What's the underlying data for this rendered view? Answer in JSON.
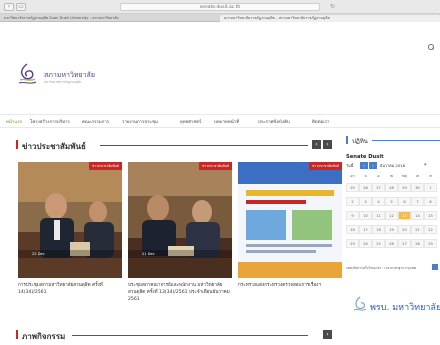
{
  "browser": {
    "url": "senate.dusit.ac.th",
    "reload_icon": "reload-icon",
    "tabs": [
      {
        "label": "มหาวิทยาลัยราชภัฏสวนดุสิต Suan Dusit University – สภามหาวิทยาลัย"
      },
      {
        "label": "สภามหาวิทยาลัยราชภัฏสวนดุสิต – สภามหาวิทยาลัยราชภัฏสวนดุสิต"
      }
    ]
  },
  "header": {
    "logo_text": "สภามหาวิทยาลัย",
    "logo_sub": "มหาวิทยาลัยราชภัฏสวนดุสิต"
  },
  "nav": {
    "items": [
      {
        "label": "หน้าแรก"
      },
      {
        "label": "โครงสร้างการบริหาร"
      },
      {
        "label": "คณะกรรมการ"
      },
      {
        "label": "รายงานการประชุม"
      },
      {
        "label": "ยุทธศาสตร์"
      },
      {
        "label": "บทบาทหน้าที่"
      },
      {
        "label": "ประกาศข้อบังคับ"
      },
      {
        "label": "ติดต่อเรา"
      }
    ]
  },
  "news": {
    "title": "ข่าวประชาสัมพันธ์",
    "prev": "‹",
    "next": "›",
    "cards": [
      {
        "badge": "ข่าวประชาสัมพันธ์",
        "meta": "22 Dec",
        "caption": "การประชุมสภามหาวิทยาลัยสวนดุสิต ครั้งที่ 14(34)/2561"
      },
      {
        "badge": "ข่าวประชาสัมพันธ์",
        "meta": "21 Dec",
        "caption": "ประชุมสภาคณาจารย์และพนักงาน มหาวิทยาลัยสวนดุสิต ครั้งที่ 13(34)/2561 ประจำเดือนธันวาคม 2561"
      },
      {
        "badge": "ข่าวประชาสัมพันธ์",
        "meta": "",
        "caption": "กระทรวงแต่งกระทรวงตรวจสอบการเรื่องฯ"
      }
    ]
  },
  "activities": {
    "title": "ภาพกิจกรรม",
    "next": "›"
  },
  "sidebar": {
    "title": "ปฏิทิน",
    "cal_title": "Senate Dusit",
    "cal_today": "วันนี้",
    "cal_month": "ธันวาคม 2018",
    "weekday_headers": [
      "อา",
      "จ",
      "อ",
      "พ",
      "พฤ",
      "ศ",
      "ส"
    ],
    "weeks": [
      [
        "25",
        "26",
        "27",
        "28",
        "29",
        "30",
        "1"
      ],
      [
        "2",
        "3",
        "4",
        "5",
        "6",
        "7",
        "8"
      ],
      [
        "9",
        "10",
        "11",
        "12",
        "13",
        "14",
        "15"
      ],
      [
        "16",
        "17",
        "18",
        "19",
        "20",
        "21",
        "22"
      ],
      [
        "23",
        "24",
        "25",
        "26",
        "27",
        "28",
        "29"
      ]
    ],
    "footer": "แสดงกิจกรรมในโซนเวลา : เวลามาตรฐาน กรุงเทพ",
    "banner": "พรบ. มหาวิทยาลัย"
  },
  "colors": {
    "accent_red": "#c62828",
    "accent_blue": "#4a7fc8",
    "logo_purple": "#5c3a8c",
    "nav_active": "#6f8f2e"
  }
}
